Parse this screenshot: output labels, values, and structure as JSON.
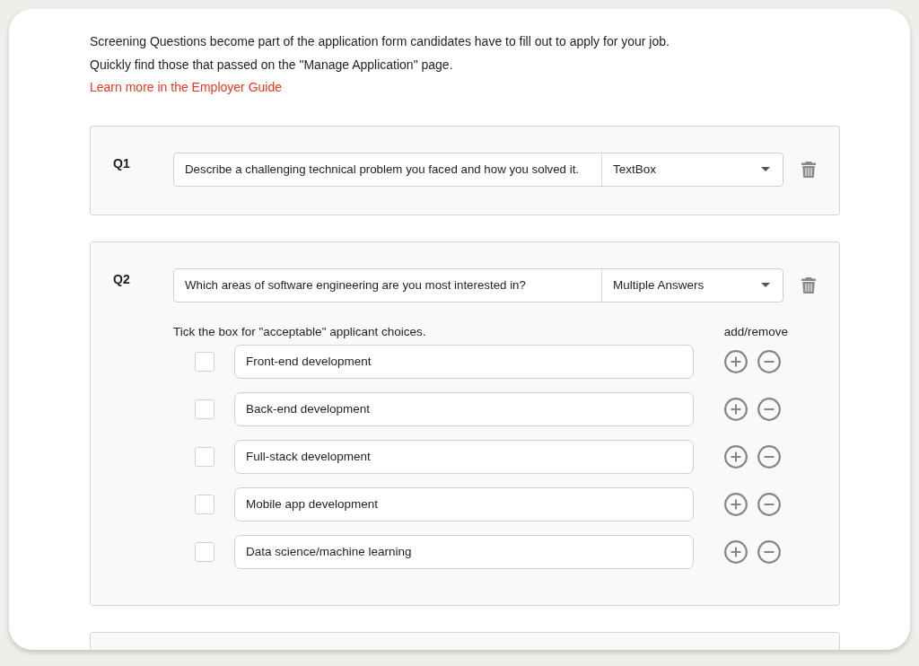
{
  "intro": {
    "lines": [
      "Screening Questions become part of the application form candidates have to fill out to apply for your job.",
      "Quickly find those that passed on the \"Manage Application\" page."
    ],
    "link": "Learn more in the Employer Guide"
  },
  "questions": [
    {
      "kind": "text",
      "label": "Q1",
      "question": "Describe a challenging technical problem you faced and how you solved it.",
      "answer_type": "TextBox"
    },
    {
      "kind": "choices",
      "label": "Q2",
      "question": "Which areas of software engineering are you most interested in?",
      "answer_type": "Multiple Answers",
      "hint": "Tick the box for \"acceptable\" applicant choices.",
      "actions_label": "add/remove",
      "choices": [
        {
          "text": "Front-end development",
          "checked": false
        },
        {
          "text": "Back-end development",
          "checked": false
        },
        {
          "text": "Full-stack development",
          "checked": false
        },
        {
          "text": "Mobile app development",
          "checked": false
        },
        {
          "text": "Data science/machine learning",
          "checked": false
        }
      ]
    }
  ]
}
